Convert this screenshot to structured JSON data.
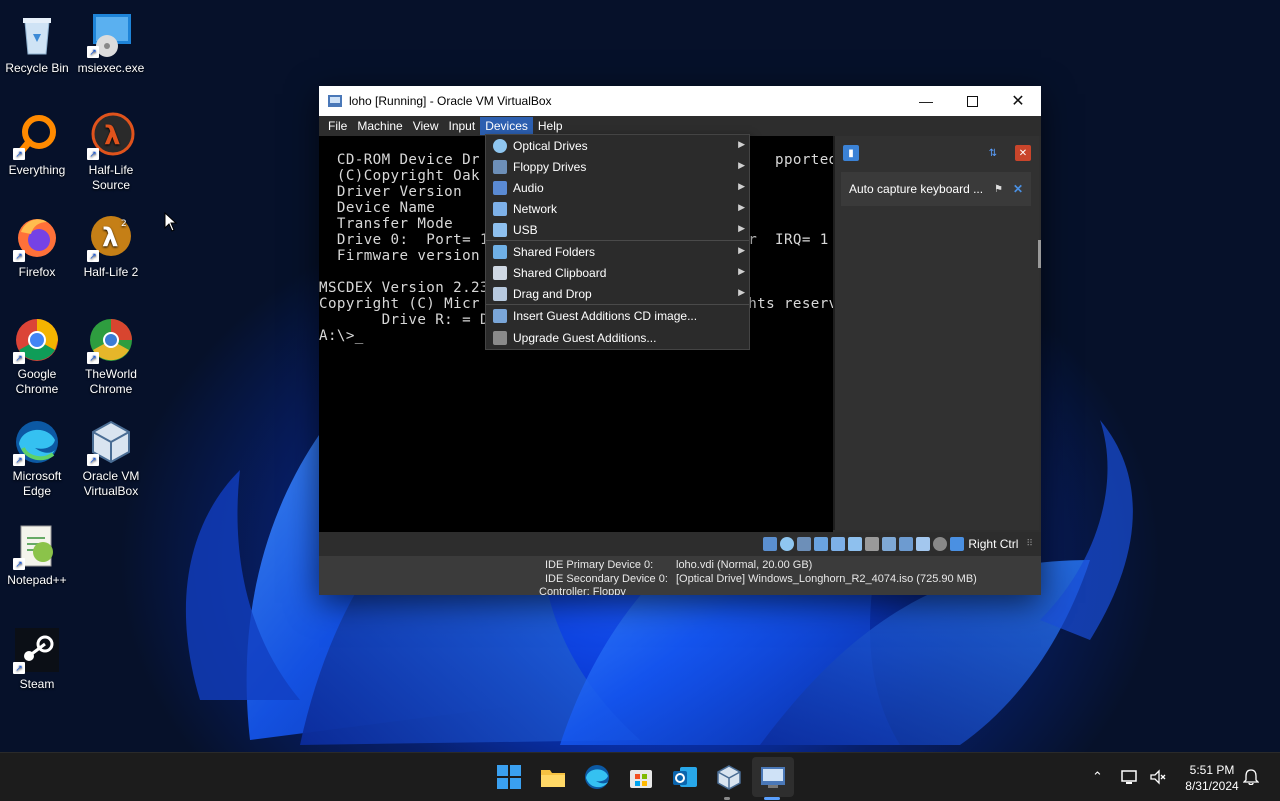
{
  "desktop": {
    "icons": [
      {
        "label": "Recycle Bin",
        "icon": "recycle-bin-icon"
      },
      {
        "label": "msiexec.exe",
        "icon": "installer-icon"
      },
      {
        "label": "Everything",
        "icon": "everything-search-icon"
      },
      {
        "label": "Half-Life Source",
        "icon": "half-life-icon"
      },
      {
        "label": "Firefox",
        "icon": "firefox-icon"
      },
      {
        "label": "Half-Life 2",
        "icon": "half-life-2-icon"
      },
      {
        "label": "Google Chrome",
        "icon": "chrome-icon"
      },
      {
        "label": "TheWorld Chrome",
        "icon": "theworld-chrome-icon"
      },
      {
        "label": "Microsoft Edge",
        "icon": "edge-icon"
      },
      {
        "label": "Oracle VM VirtualBox",
        "icon": "virtualbox-icon"
      },
      {
        "label": "Notepad++",
        "icon": "notepadpp-icon"
      },
      {
        "label": "Steam",
        "icon": "steam-icon"
      }
    ]
  },
  "window": {
    "title": "loho [Running] - Oracle VM VirtualBox",
    "menu": [
      "File",
      "Machine",
      "View",
      "Input",
      "Devices",
      "Help"
    ],
    "active_menu": "Devices",
    "console_lines": [
      "",
      "  CD-ROM Device Dr                                 pported)",
      "  (C)Copyright Oak",
      "  Driver Version",
      "  Device Name",
      "  Transfer Mode",
      "  Drive 0:  Port= 1                             r  IRQ= 1",
      "  Firmware version",
      "",
      "MSCDEX Version 2.23",
      "Copyright (C) Micr                              hts reserved.",
      "       Drive R: = D",
      "A:\\>_"
    ],
    "notification": "Auto capture keyboard ...",
    "host_key": "Right Ctrl",
    "details": {
      "ide_primary_label": "IDE Primary Device 0:",
      "ide_primary_value": "loho.vdi (Normal, 20.00 GB)",
      "ide_secondary_label": "IDE Secondary Device 0:",
      "ide_secondary_value": "[Optical Drive] Windows_Longhorn_R2_4074.iso (725.90 MB)",
      "controller": "Controller: Floppy"
    }
  },
  "devices_menu": {
    "items": [
      {
        "label": "Optical Drives",
        "icon": "optical-drive-icon",
        "submenu": true
      },
      {
        "label": "Floppy Drives",
        "icon": "floppy-icon",
        "submenu": true
      },
      {
        "label": "Audio",
        "icon": "audio-icon",
        "submenu": true
      },
      {
        "label": "Network",
        "icon": "network-icon",
        "submenu": true
      },
      {
        "label": "USB",
        "icon": "usb-icon",
        "submenu": true
      },
      {
        "label": "Shared Folders",
        "icon": "shared-folder-icon",
        "submenu": true
      },
      {
        "label": "Shared Clipboard",
        "icon": "clipboard-icon",
        "submenu": true
      },
      {
        "label": "Drag and Drop",
        "icon": "drag-drop-icon",
        "submenu": true
      },
      {
        "label": "Insert Guest Additions CD image...",
        "icon": "guest-additions-icon",
        "submenu": false
      },
      {
        "label": "Upgrade Guest Additions...",
        "icon": "upgrade-icon",
        "submenu": false
      }
    ]
  },
  "taskbar": {
    "apps": [
      "start-icon",
      "file-explorer-icon",
      "edge-icon",
      "microsoft-store-icon",
      "outlook-icon",
      "virtualbox-icon",
      "vm-window-icon"
    ],
    "time": "5:51 PM",
    "date": "8/31/2024"
  },
  "colors": {
    "menu_highlight": "#2c5fb0",
    "taskbar": "#1c1c1c",
    "window_bg": "#2b2b2b"
  }
}
